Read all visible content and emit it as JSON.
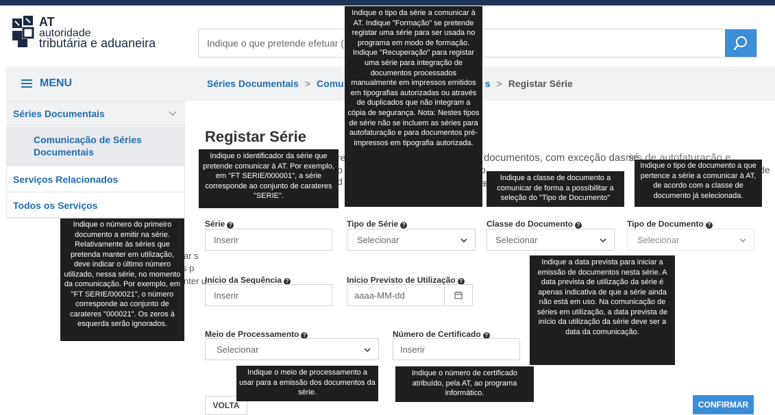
{
  "brand": {
    "line1": "AT",
    "line2": "autoridade",
    "line3": "tributária e aduaneira"
  },
  "search": {
    "placeholder": "Indique o que pretende efetuar (",
    "button_icon": "search-icon"
  },
  "sidebar": {
    "menu_label": "MENU",
    "items": [
      {
        "label": "Séries Documentais"
      },
      {
        "label": "Comunicação de Séries Documentais"
      },
      {
        "label": "Serviços Relacionados"
      },
      {
        "label": "Todos os Serviços"
      }
    ]
  },
  "breadcrumb": {
    "item1": "Séries Documentais",
    "item2": "Comu",
    "item3_tail": "s",
    "current": "Registar Série",
    "separator": ">"
  },
  "page": {
    "title": "Registar Série",
    "intro_fragments": [
      "re",
      "documentos, com exceção das sé",
      "ries de autofaturação e",
      "p",
      "d",
      "o",
      "rs",
      "s",
      "de"
    ],
    "hidden_fragments": [
      "ar s",
      "s p",
      "nter u"
    ]
  },
  "form": {
    "serie": {
      "label": "Série",
      "placeholder": "Inserir"
    },
    "tipo_serie": {
      "label": "Tipo de Série",
      "value": "Selecionar"
    },
    "classe": {
      "label": "Classe do Documento",
      "value": "Selecionar"
    },
    "tipo_doc": {
      "label": "Tipo de Documento",
      "value": "Selecionar"
    },
    "inicio_seq": {
      "label": "Início da Sequência",
      "placeholder": "Inserir"
    },
    "inicio_prev": {
      "label": "Início Previsto de Utilização",
      "placeholder": "aaaa-MM-dd"
    },
    "meio": {
      "label": "Meio de Processamento",
      "value": "Selecionar"
    },
    "certificado": {
      "label": "Número de Certificado",
      "placeholder": "Inserir"
    }
  },
  "buttons": {
    "back": "VOLTA",
    "confirm": "CONFIRMAR"
  },
  "tooltips": {
    "tipo_serie": "Indique o tipo da série a comunicar à AT. Indique \"Formação\" se pretende registar uma série para ser usada no programa em modo de formação. Indique \"Recuperação\" para registar uma série para integração de documentos processados manualmente em impressos emitidos em tipografias autorizadas ou através de duplicados que não integram a cópia de segurança. Nota: Nestes tipos de série não se incluem as séries para autofaturação e para documentos pré-impressos em tipografia autorizada.",
    "serie": "Indique o identificador da série que pretende comunicar à AT. Por exemplo, em \"FT SERIE/000001\", a série corresponde ao conjunto de carateres \"SERIE\".",
    "classe": "Indique a classe de documento a comunicar de forma a possibilitar a seleção do \"Tipo de Documento\"",
    "tipo_doc": "Indique o tipo de documento a que pertence a série a comunicar à AT, de acordo com a classe de documento já selecionada.",
    "inicio_seq": "Indique o número do primeiro documento a emitir na série. Relativamente às séries que pretenda manter em utilização, deve indicar o último número utilizado, nessa série, no momento da comunicação. Por exemplo, em \"FT SERIE/000021\", o número corresponde ao conjunto de carateres \"000021\". Os zeros à esquerda serão ignorados.",
    "inicio_prev": "Indique a data prevista para iniciar a emissão de documentos nesta série. A data prevista de utilização da série é apenas indicativa de que a série ainda não está em uso. Na comunicação de séries em utilização, a data prevista de início da utilização da série deve ser a data da comunicação.",
    "meio": "Indique o meio de processamento a usar para a emissão dos documentos da série.",
    "certificado": "Indique o número de certificado atribuído, pela AT, ao programa informático."
  },
  "colors": {
    "accent": "#3c8dd8",
    "link": "#1e6db3",
    "topbar": "#1e3557",
    "tooltip_bg": "#1f1f1f"
  }
}
